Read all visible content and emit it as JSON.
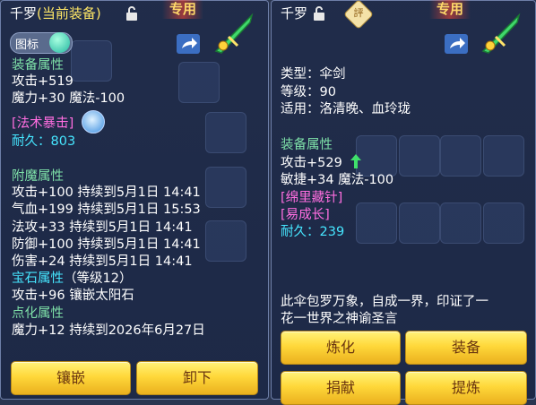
{
  "left": {
    "title_name": "千罗",
    "title_status": "(当前装备)",
    "tag_special": "专用",
    "toggle_label": "图标",
    "section_equip": "装备属性",
    "equip_lines": [
      "攻击+519",
      "魔力+30 魔法-100"
    ],
    "skill_tag": "[法术暴击]",
    "durability": "耐久：803",
    "section_enchant": "附魔属性",
    "enchant_lines": [
      "攻击+100 持续到5月1日 14:41",
      "气血+199 持续到5月1日 15:53",
      "法攻+33 持续到5月1日 14:41",
      "防御+100 持续到5月1日 14:41",
      "伤害+24 持续到5月1日 14:41"
    ],
    "gem_label": "宝石属性",
    "gem_level": "（等级12）",
    "gem_line": "攻击+96 镶嵌太阳石",
    "section_refine": "点化属性",
    "refine_line": "魔力+12 持续到2026年6月27日",
    "buttons": {
      "inlay": "镶嵌",
      "unequip": "卸下"
    }
  },
  "right": {
    "title_name": "千罗",
    "badge": "評",
    "tag_special": "专用",
    "info_lines": [
      "类型：伞剑",
      "等级：90",
      "适用：洛清晚、血玲珑"
    ],
    "section_equip": "装备属性",
    "attack": "攻击+529",
    "agility": "敏捷+34 魔法-100",
    "tag1": "[绵里藏针]",
    "tag2": "[易成长]",
    "durability": "耐久：239",
    "description": [
      "此伞包罗万象，自成一界，印证了一",
      "花一世界之神谕圣言"
    ],
    "buttons": {
      "refine": "炼化",
      "equip": "装备",
      "donate": "捐献",
      "extract": "提炼"
    }
  }
}
